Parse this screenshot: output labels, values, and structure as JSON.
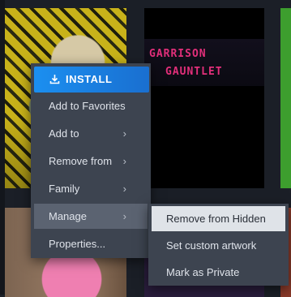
{
  "library": {
    "tiles": [
      {
        "id": "tile-anime-art"
      },
      {
        "id": "tile-garrison-gauntlet",
        "title_line1": "GARRISON",
        "title_line2": "GAUNTLET"
      },
      {
        "id": "tile-green"
      },
      {
        "id": "tile-pink-character"
      },
      {
        "id": "tile-purple"
      },
      {
        "id": "tile-red"
      }
    ]
  },
  "context_menu": {
    "install_label": "INSTALL",
    "items": [
      {
        "label": "Add to Favorites",
        "has_submenu": false
      },
      {
        "label": "Add to",
        "has_submenu": true
      },
      {
        "label": "Remove from",
        "has_submenu": true
      },
      {
        "label": "Family",
        "has_submenu": true
      },
      {
        "label": "Manage",
        "has_submenu": true,
        "highlighted": true
      },
      {
        "label": "Properties...",
        "has_submenu": false
      }
    ],
    "chevron_glyph": "›"
  },
  "manage_submenu": {
    "items": [
      {
        "label": "Remove from Hidden",
        "highlighted": true
      },
      {
        "label": "Set custom artwork"
      },
      {
        "label": "Mark as Private"
      }
    ]
  },
  "colors": {
    "menu_bg": "#3d4450",
    "install_blue": "#1a8ff0",
    "hover_bg": "#5b6371",
    "submenu_hover_bg": "#dfe3e8"
  },
  "icons": {
    "install": "download-icon",
    "submenu": "chevron-right-icon"
  }
}
